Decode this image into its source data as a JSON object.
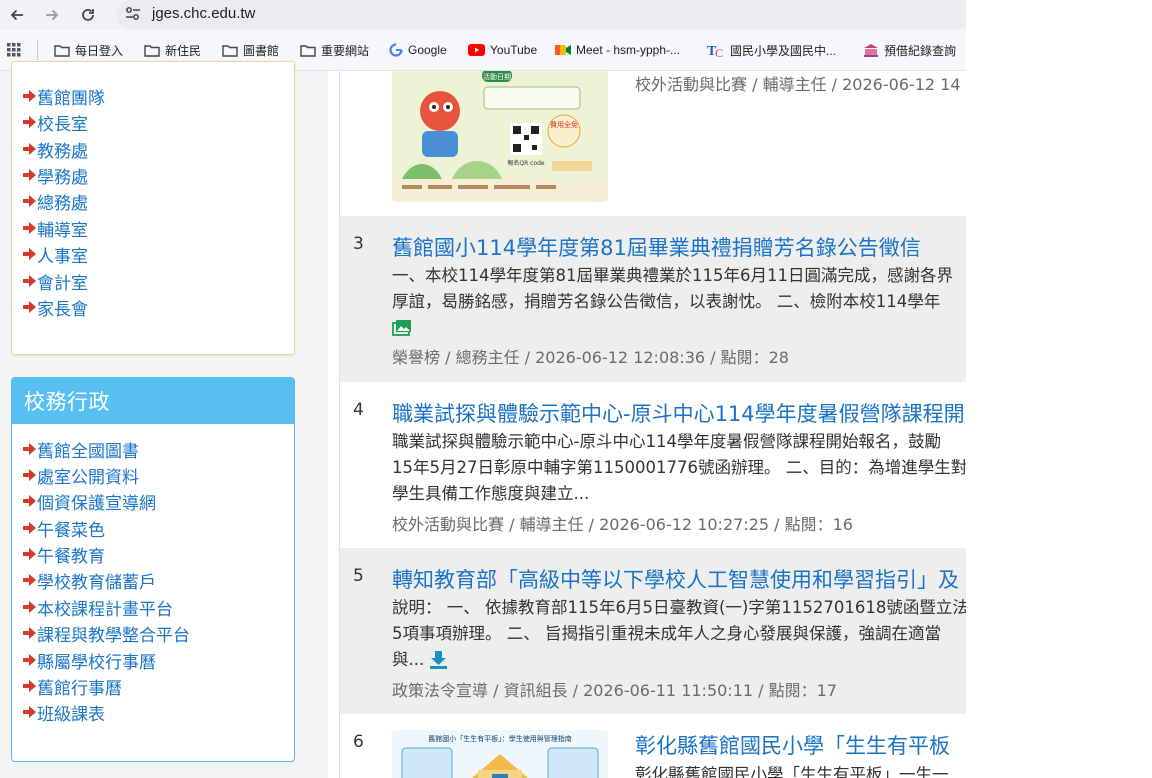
{
  "browser": {
    "url": "jges.chc.edu.tw",
    "bookmarks": [
      {
        "label": "每日登入",
        "icon": "folder-icon"
      },
      {
        "label": "新住民",
        "icon": "folder-icon"
      },
      {
        "label": "圖書館",
        "icon": "folder-icon"
      },
      {
        "label": "重要網站",
        "icon": "folder-icon"
      },
      {
        "label": "Google",
        "icon": "google-icon"
      },
      {
        "label": "YouTube",
        "icon": "youtube-icon"
      },
      {
        "label": "Meet - hsm-ypph-...",
        "icon": "meet-icon"
      },
      {
        "label": "國民小學及國民中...",
        "icon": "tc-icon"
      },
      {
        "label": "預借紀錄查詢",
        "icon": "library-icon"
      }
    ]
  },
  "sidebar": {
    "top_links": [
      "舊館團隊",
      "校長室",
      "教務處",
      "學務處",
      "總務處",
      "輔導室",
      "人事室",
      "會計室",
      "家長會"
    ],
    "admin_title": "校務行政",
    "admin_links": [
      "舊館全國圖書",
      "處室公開資料",
      "個資保護宣導網",
      "午餐菜色",
      "午餐教育",
      "學校教育儲蓄戶",
      "本校課程計畫平台",
      "課程與教學整合平台",
      "縣屬學校行事曆",
      "舊館行事曆",
      "班級課表"
    ]
  },
  "news": {
    "item2": {
      "meta": "校外活動與比賽 / 輔導主任 / 2026-06-12 14",
      "poster_badge": "活動日期",
      "poster_free": "費用全免",
      "poster_qr": "報名QR code"
    },
    "item3": {
      "num": "3",
      "title": "舊館國小114學年度第81屆畢業典禮捐贈芳名錄公告徵信",
      "line1": "一、本校114學年度第81屆畢業典禮業於115年6月11日圓滿完成，感謝各界",
      "line2": "厚誼，曷勝銘感，捐贈芳名錄公告徵信，以表謝忱。 二、檢附本校114學年",
      "meta": "榮譽榜 / 總務主任 / 2026-06-12 12:08:36 / 點閱：28"
    },
    "item4": {
      "num": "4",
      "title": "職業試探與體驗示範中心-原斗中心114學年度暑假營隊課程開",
      "line1": "職業試探與體驗示範中心-原斗中心114學年度暑假營隊課程開始報名，鼓勵",
      "line2": "15年5月27日彰原中輔字第1150001776號函辦理。 二、目的：為增進學生對",
      "line3": "學生具備工作態度與建立...",
      "meta": "校外活動與比賽 / 輔導主任 / 2026-06-12 10:27:25 / 點閱：16"
    },
    "item5": {
      "num": "5",
      "title": "轉知教育部「高級中等以下學校人工智慧使用和學習指引」及",
      "line1": "說明： 一、 依據教育部115年6月5日臺教資(一)字第1152701618號函暨立法",
      "line2": "5項事項辦理。 二、 旨揭指引重視未成年人之身心發展與保護，強調在適當",
      "line3": "與...",
      "meta": "政策法令宣導 / 資訊組長 / 2026-06-11 11:50:11 / 點閱：17"
    },
    "item6": {
      "num": "6",
      "title": "彰化縣舊館國民小學「生生有平板",
      "line1": "彰化縣舊館國民小學「生生有平板」一生一",
      "poster_title": "舊館國小「生生有平板」：學生使用與管理指南"
    }
  },
  "colors": {
    "link": "#1976c9",
    "admin_header": "#57bff2",
    "title_blue": "#1a73c7",
    "arrow_red": "#d9382c"
  }
}
